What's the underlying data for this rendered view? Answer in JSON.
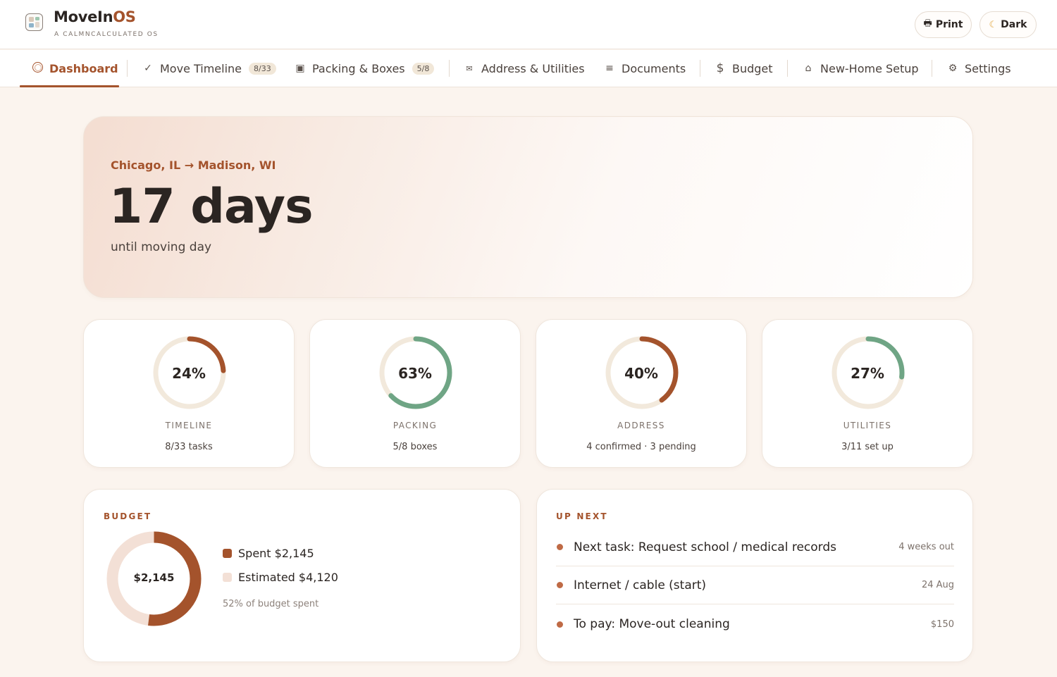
{
  "app": {
    "name_prefix": "MoveIn",
    "name_accent": "OS",
    "tagline": "A CALMNCALCULATED OS"
  },
  "header": {
    "print_label": "Print",
    "print_icon": "printer-icon",
    "dark_label": "Dark",
    "dark_icon": "moon-icon"
  },
  "nav": {
    "tabs": [
      {
        "label": "Dashboard",
        "icon": "ring-icon",
        "active": true
      },
      {
        "label": "Move Timeline",
        "icon": "check-icon",
        "badge": "8/33"
      },
      {
        "label": "Packing & Boxes",
        "icon": "box-icon",
        "badge": "5/8"
      },
      {
        "label": "Address & Utilities",
        "icon": "envelope-icon"
      },
      {
        "label": "Documents",
        "icon": "list-icon"
      },
      {
        "label": "Budget",
        "icon": "dollar-icon"
      },
      {
        "label": "New-Home Setup",
        "icon": "home-icon"
      },
      {
        "label": "Settings",
        "icon": "gear-icon"
      }
    ]
  },
  "hero": {
    "route": "Chicago, IL → Madison, WI",
    "countdown": "17 days",
    "subtitle": "until moving day"
  },
  "stats": [
    {
      "percent_label": "24%",
      "percent": 24,
      "label": "TIMELINE",
      "detail": "8/33 tasks",
      "color": "#a4532c"
    },
    {
      "percent_label": "63%",
      "percent": 63,
      "label": "PACKING",
      "detail": "5/8 boxes",
      "color": "#6fa585"
    },
    {
      "percent_label": "40%",
      "percent": 40,
      "label": "ADDRESS",
      "detail": "4 confirmed · 3 pending",
      "color": "#a4532c"
    },
    {
      "percent_label": "27%",
      "percent": 27,
      "label": "UTILITIES",
      "detail": "3/11 set up",
      "color": "#6fa585"
    }
  ],
  "budget": {
    "title": "BUDGET",
    "center_value": "$2,145",
    "spent_fraction": 0.52,
    "spent_label": "Spent $2,145",
    "estimated_label": "Estimated $4,120",
    "note": "52% of budget spent",
    "spent_color": "#a4532c",
    "estimated_color": "#f3e0d6"
  },
  "upnext": {
    "title": "UP NEXT",
    "items": [
      {
        "text": "Next task: Request school / medical records",
        "meta": "4 weeks out"
      },
      {
        "text": "Internet / cable (start)",
        "meta": "24 Aug"
      },
      {
        "text": "To pay: Move-out cleaning",
        "meta": "$150"
      }
    ]
  }
}
